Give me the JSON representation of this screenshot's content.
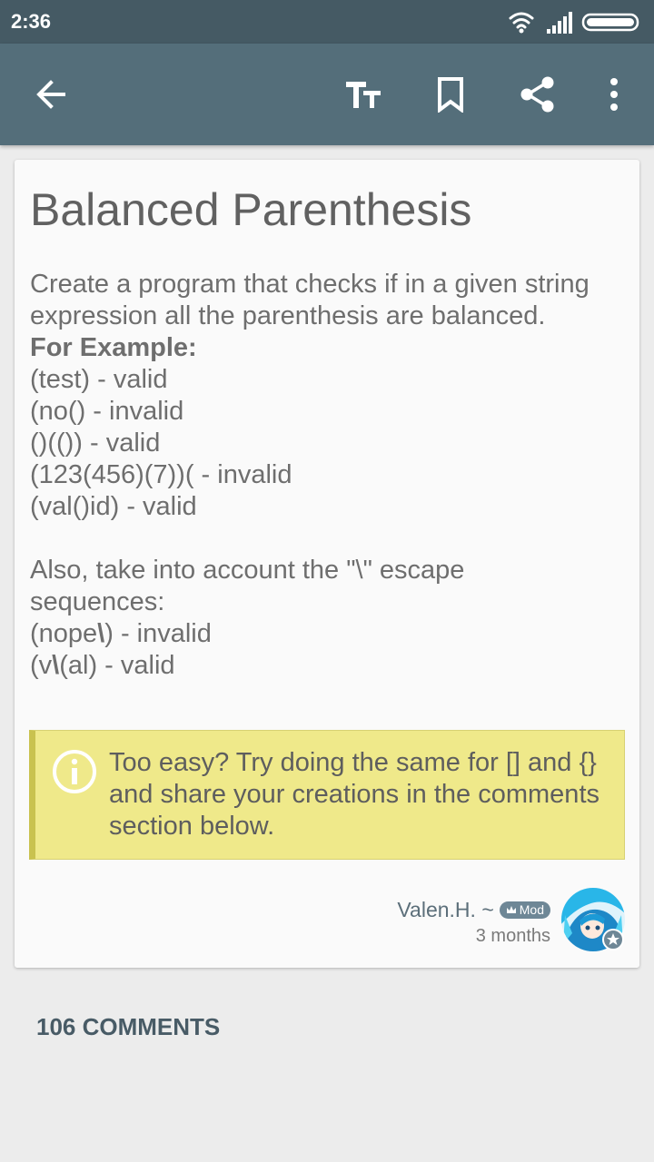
{
  "status_bar": {
    "time": "2:36"
  },
  "app_bar": {
    "icons": [
      "back-arrow-icon",
      "text-size-icon",
      "bookmark-icon",
      "share-icon",
      "more-vert-icon"
    ]
  },
  "post": {
    "title": "Balanced Parenthesis",
    "intro_1": "Create a program that checks if in a given string",
    "intro_2": "expression all the parenthesis are balanced.",
    "example_heading": "For Example:",
    "examples": [
      "(test) - valid",
      "(no() - invalid",
      "()(()) - valid",
      "(123(456)(7))( - invalid",
      "(val()id) - valid"
    ],
    "escape_1": "Also, take into account the \"\\\" escape",
    "escape_2": "sequences:",
    "escape_examples": [
      {
        "pre": "(nope",
        "bold": "\\",
        "post": ") - invalid"
      },
      {
        "pre": "(v",
        "bold": "\\",
        "post": "(al) - valid"
      }
    ],
    "tip": "Too easy? Try doing the same for [] and {} and share your creations in the comments section below.",
    "author": "Valen.H. ~",
    "badge": "Mod",
    "time_ago": "3 months"
  },
  "comments": {
    "label": "106 COMMENTS"
  },
  "colors": {
    "status_bar": "#455a64",
    "app_bar": "#546e7a",
    "tip_background": "#efe98a",
    "tip_border": "#c9c24f",
    "background": "#ececec"
  }
}
